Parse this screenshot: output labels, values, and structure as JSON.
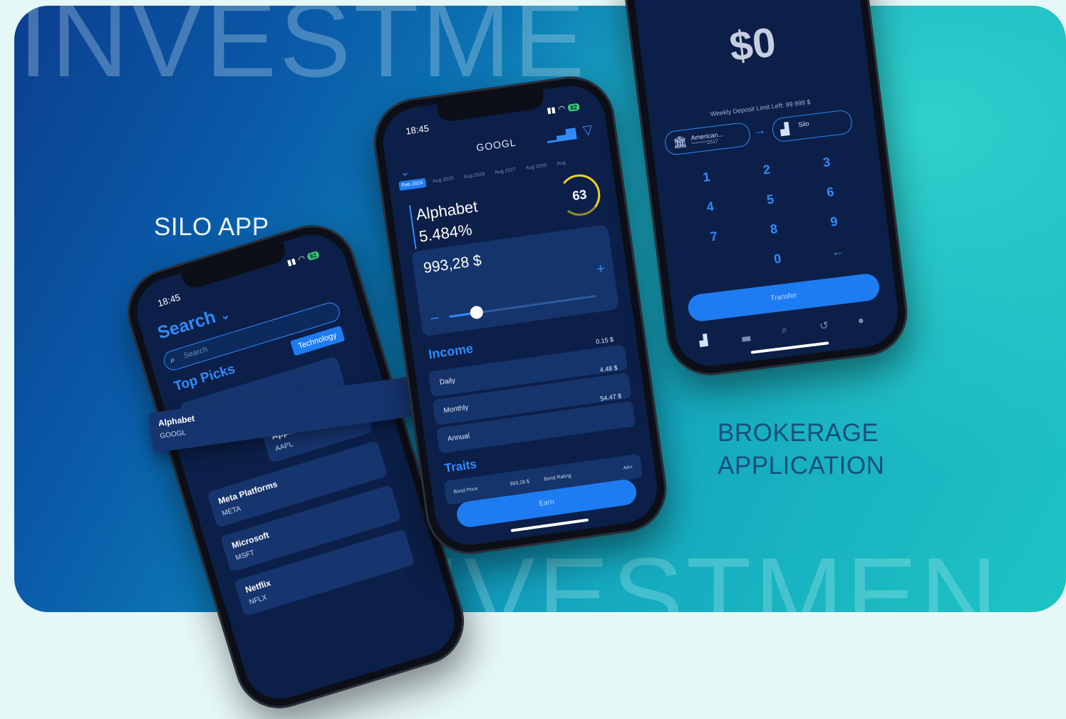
{
  "background": {
    "word_top": "INVESTME",
    "word_bottom": "IVESTMEN",
    "label_left": "SILO APP",
    "label_right_line1": "BROKERAGE",
    "label_right_line2": "APPLICATION"
  },
  "colors": {
    "accent": "#2e8cff",
    "screen_bg": "#0b1f48",
    "card_bg": "#16356f",
    "gauge": "#f1d219"
  },
  "phone_search": {
    "time": "18:45",
    "battery": "82",
    "title": "Search",
    "search_placeholder": "Search",
    "filter_chip": "Technology",
    "section": "Top Picks",
    "picks": [
      {
        "name": "Alphabet",
        "ticker": "GOOGL"
      },
      {
        "name": "Apple",
        "ticker": "AAPL"
      },
      {
        "name": "Meta Platforms",
        "ticker": "META"
      },
      {
        "name": "Microsoft",
        "ticker": "MSFT"
      },
      {
        "name": "Netflix",
        "ticker": "NFLX"
      }
    ]
  },
  "phone_detail": {
    "time": "18:45",
    "battery": "82",
    "ticker": "GOOGL",
    "dates": [
      "Feb 2024",
      "Aug 2025",
      "Aug 2026",
      "Aug 2027",
      "Aug 2030",
      "Aug"
    ],
    "name": "Alphabet",
    "rate": "5.484%",
    "score": "63",
    "score_value": 63,
    "amount": "993,28 $",
    "slider_fraction": 0.2,
    "income_title": "Income",
    "income_rows": [
      {
        "label": "Daily",
        "value": "0.15 $"
      },
      {
        "label": "Monthly",
        "value": "4.48 $"
      },
      {
        "label": "Annual",
        "value": "54.47 $"
      }
    ],
    "traits_title": "Traits",
    "traits": {
      "bond_price_label": "Bond Price",
      "bond_price_value": "993,28 $",
      "bond_rating_label": "Bond Rating",
      "bond_rating_value": "AA+"
    },
    "earn_button": "Earn"
  },
  "phone_transfer": {
    "amount": "$0",
    "limit_text": "Weekly Deposit Limit Left: 99 899 $",
    "from_name": "American...",
    "from_account": "********2517",
    "to_name": "Silo",
    "keys": [
      "1",
      "2",
      "3",
      "4",
      "5",
      "6",
      "7",
      "8",
      "9",
      "0",
      "←"
    ],
    "transfer_button": "Transfer"
  }
}
